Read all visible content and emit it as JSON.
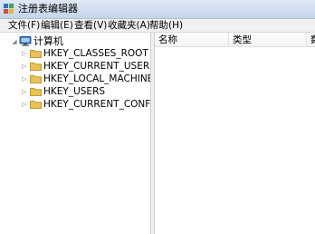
{
  "window": {
    "title": "注册表编辑器"
  },
  "menu": [
    {
      "label": "文件(F)"
    },
    {
      "label": "编辑(E)"
    },
    {
      "label": "查看(V)"
    },
    {
      "label": "收藏夹(A)"
    },
    {
      "label": "帮助(H)"
    }
  ],
  "tree": {
    "root": {
      "label": "计算机",
      "expander": "◢"
    },
    "children": [
      {
        "label": "HKEY_CLASSES_ROOT",
        "expander": "▷"
      },
      {
        "label": "HKEY_CURRENT_USER",
        "expander": "▷"
      },
      {
        "label": "HKEY_LOCAL_MACHINE",
        "expander": "▷"
      },
      {
        "label": "HKEY_USERS",
        "expander": "▷"
      },
      {
        "label": "HKEY_CURRENT_CONFIG",
        "expander": "▷"
      }
    ]
  },
  "list": {
    "columns": [
      {
        "label": "名称"
      },
      {
        "label": "类型"
      },
      {
        "label": "数"
      }
    ]
  },
  "colors": {
    "folder": "#e8c25a",
    "folder_dark": "#c9982a",
    "titlebar": "#c4d5ea"
  }
}
